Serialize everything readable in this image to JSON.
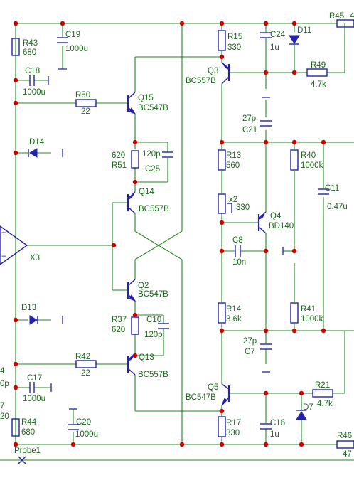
{
  "labels": {
    "R45": "R45",
    "R45_val": "4",
    "R43": "R43",
    "R43_val": "680",
    "C19": "C19",
    "C19_val": "1000u",
    "C18": "C18",
    "C18_val": "1000u",
    "R50": "R50",
    "R50_val": "22",
    "Q15": "Q15",
    "Q15_type": "BC547B",
    "D14": "D14",
    "R51_val": "620",
    "R51": "R51",
    "C25_val": "120p",
    "C25": "C25",
    "Q14": "Q14",
    "Q14_type": "BC557B",
    "X3": "X3",
    "Q2": "Q2",
    "Q2_type": "BC547B",
    "D13": "D13",
    "R37": "R37",
    "R37_val": "620",
    "C10": "C10",
    "C10_val": "120p",
    "Q13": "Q13",
    "Q13_type": "BC557B",
    "R42": "R42",
    "R42_val": "22",
    "C17": "C17",
    "C17_val": "1000u",
    "C20": "C20",
    "C20_val": "1000u",
    "R44": "R44",
    "R44_val": "680",
    "probe": "Probe1",
    "R15": "R15",
    "R15_val": "330",
    "C24": "C24",
    "C24_val": "1u",
    "D11": "D11",
    "Q3": "Q3",
    "Q3_type": "BC557B",
    "R49": "R49",
    "R49_val": "4.7k",
    "C21_val": "27p",
    "C21": "C21",
    "R13": "R13",
    "R13_val": "560",
    "R40": "R40",
    "R40_val": "1000k",
    "C11": "C11",
    "C11_val": "0.47u",
    "x2": "x2",
    "x2_val": "330",
    "Q4": "Q4",
    "Q4_type": "BD140",
    "C8": "C8",
    "C8_val": "10n",
    "R14": "R14",
    "R14_val": "3.6k",
    "R41": "R41",
    "R41_val": "1000k",
    "C7_val": "27p",
    "C7": "C7",
    "Q5": "Q5",
    "Q5_type": "BC547B",
    "R21": "R21",
    "R21_val": "4.7k",
    "D7": "D7",
    "R17": "R17",
    "R17_val": "330",
    "C16": "C16",
    "C16_val": "1u",
    "R46": "R46",
    "R46_val": "47",
    "left_p": "0p",
    "left_4": "4",
    "left_7": "7",
    "left_20": "20",
    "opamp_plus": "+",
    "opamp_minus": "−"
  }
}
